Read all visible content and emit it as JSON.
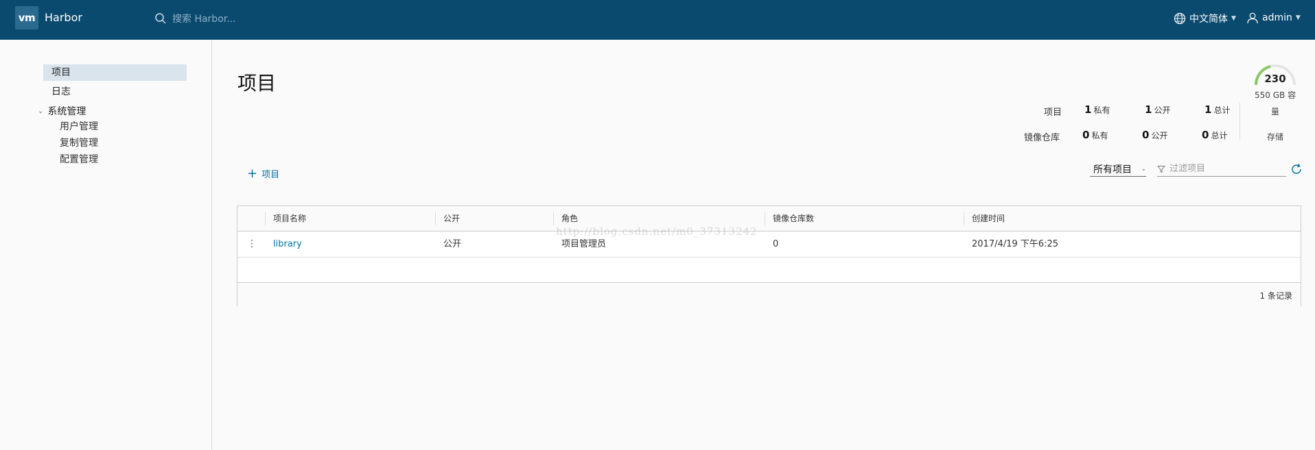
{
  "header": {
    "logo": "vm",
    "title": "Harbor",
    "search_placeholder": "搜索 Harbor...",
    "language": "中文简体",
    "user": "admin"
  },
  "sidebar": {
    "items": [
      {
        "label": "项目",
        "active": true
      },
      {
        "label": "日志",
        "active": false
      }
    ],
    "group": {
      "label": "系统管理",
      "children": [
        "用户管理",
        "复制管理",
        "配置管理"
      ]
    }
  },
  "main": {
    "title": "项目",
    "storage": {
      "value": "230",
      "caption": "550 GB 容",
      "caption2": "量",
      "label": "存储",
      "fill_fraction": 0.42
    },
    "stats": {
      "projects_label": "项目",
      "repos_label": "镜像仓库",
      "projects": {
        "private": "1",
        "public": "1",
        "total": "1"
      },
      "repos": {
        "private": "0",
        "public": "0",
        "total": "0"
      },
      "private_label": "私有",
      "public_label": "公开",
      "total_label": "总计"
    },
    "add_button": "项目",
    "filter_select": "所有项目",
    "filter_placeholder": "过滤项目",
    "table": {
      "columns": [
        "项目名称",
        "公开",
        "角色",
        "镜像仓库数",
        "创建时间"
      ],
      "rows": [
        {
          "name": "library",
          "public": "公开",
          "role": "项目管理员",
          "repos": "0",
          "created": "2017/4/19 下午6:25"
        }
      ],
      "footer": "1 条记录"
    },
    "watermark": "http://blog.csdn.net/m0_37313242"
  },
  "colors": {
    "header_bg": "#0b4a6f",
    "accent": "#0072a3",
    "gauge_green": "#8cc665"
  }
}
